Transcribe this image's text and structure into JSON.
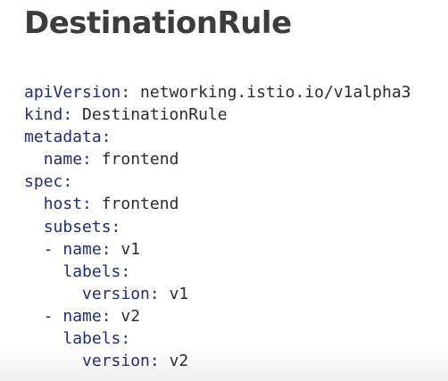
{
  "slide": {
    "title": "DestinationRule",
    "colors": {
      "title": "#3c3c3c",
      "key": "#1e2d7a",
      "value": "#2b2b2b",
      "background": "#ffffff"
    },
    "lines": [
      {
        "indent": "",
        "key": "apiVersion:",
        "value": " networking.istio.io/v1alpha3"
      },
      {
        "indent": "",
        "key": "kind:",
        "value": " DestinationRule"
      },
      {
        "indent": "",
        "key": "metadata:",
        "value": ""
      },
      {
        "indent": "  ",
        "key": "name:",
        "value": " frontend"
      },
      {
        "indent": "",
        "key": "spec:",
        "value": ""
      },
      {
        "indent": "  ",
        "key": "host:",
        "value": " frontend"
      },
      {
        "indent": "  ",
        "key": "subsets:",
        "value": ""
      },
      {
        "indent": "  - ",
        "key": "name:",
        "value": " v1"
      },
      {
        "indent": "    ",
        "key": "labels:",
        "value": ""
      },
      {
        "indent": "      ",
        "key": "version:",
        "value": " v1"
      },
      {
        "indent": "  - ",
        "key": "name:",
        "value": " v2"
      },
      {
        "indent": "    ",
        "key": "labels:",
        "value": ""
      },
      {
        "indent": "      ",
        "key": "version:",
        "value": " v2"
      }
    ]
  }
}
